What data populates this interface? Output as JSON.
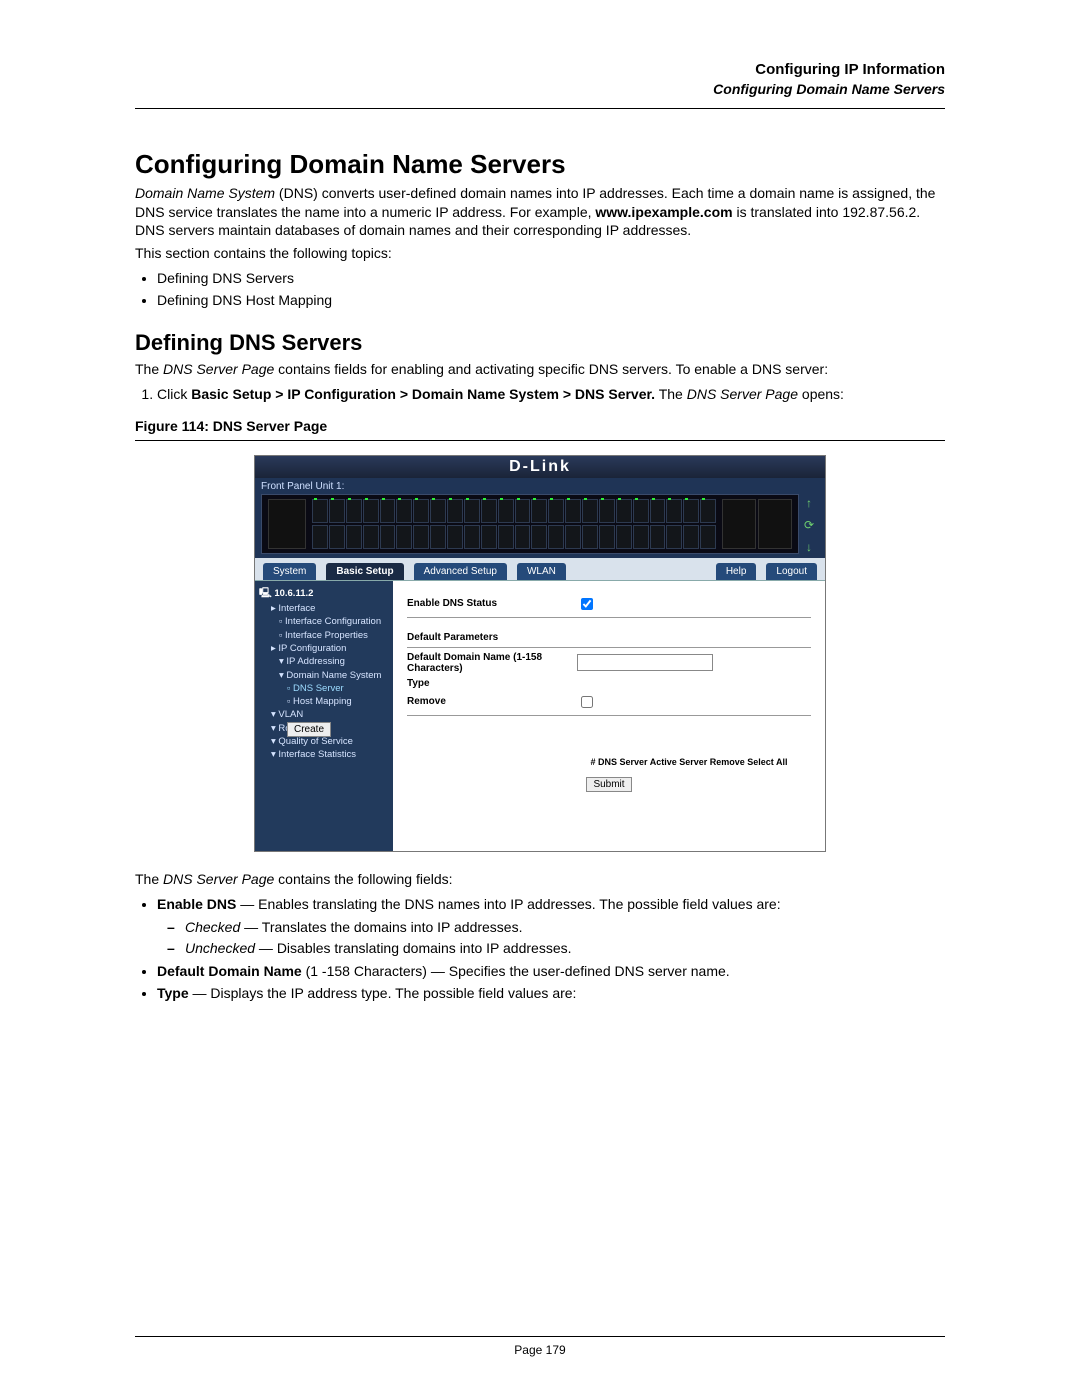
{
  "header": {
    "line1": "Configuring IP Information",
    "line2": "Configuring Domain Name Servers"
  },
  "h1": "Configuring Domain Name Servers",
  "intro_parts": {
    "a": "Domain Name System",
    "b": " (DNS) converts user-defined domain names into IP addresses. Each time a domain name is assigned, the DNS service translates the name into a numeric IP address. For example, ",
    "c": "www.ipexample.com",
    "d": " is translated into 192.87.56.2. DNS servers maintain databases of domain names and their corresponding IP addresses."
  },
  "section_contains": "This section contains the following topics:",
  "topics": [
    "Defining DNS Servers",
    "Defining DNS Host Mapping"
  ],
  "h2": "Defining DNS Servers",
  "dns_intro_parts": {
    "a": "The ",
    "b": "DNS Server Page",
    "c": " contains fields for enabling and activating specific DNS servers. To enable a DNS server:"
  },
  "step1_parts": {
    "a": "Click ",
    "b": "Basic Setup > IP Configuration > Domain Name System > DNS Server.",
    "c": " The ",
    "d": "DNS Server Page",
    "e": " opens:"
  },
  "figure_caption": "Figure 114: DNS Server Page",
  "screenshot": {
    "brand": "D-Link",
    "front_panel_label": "Front Panel Unit 1:",
    "tabs": {
      "system": "System",
      "basic": "Basic Setup",
      "advanced": "Advanced Setup",
      "wlan": "WLAN",
      "help": "Help",
      "logout": "Logout"
    },
    "sidebar": {
      "ip": "10.6.11.2",
      "items": {
        "interface": "Interface",
        "iconf": "Interface Configuration",
        "iprop": "Interface Properties",
        "ipconf": "IP Configuration",
        "ipaddr": "IP Addressing",
        "dns": "Domain Name System",
        "dnsserver": "DNS Server",
        "hostmap": "Host Mapping",
        "vlan": "VLAN",
        "routing": "Routing",
        "qos": "Quality of Service",
        "ifstats": "Interface Statistics"
      }
    },
    "form": {
      "enable_label": "Enable DNS Status",
      "default_params_hdr": "Default Parameters",
      "default_domain_label": "Default Domain Name (1-158 Characters)",
      "type_label": "Type",
      "remove_label": "Remove",
      "create_btn": "Create",
      "table_header": "# DNS Server Active Server Remove Select All",
      "submit_btn": "Submit"
    }
  },
  "fields_intro_parts": {
    "a": "The ",
    "b": "DNS Server Page",
    "c": " contains the following fields:"
  },
  "field_enable": {
    "name": "Enable DNS",
    "desc": " — Enables translating the DNS names into IP addresses. The possible field values are:"
  },
  "field_enable_checked": {
    "a": "Checked",
    "b": " — Translates the domains into IP addresses."
  },
  "field_enable_unchecked": {
    "a": "Unchecked",
    "b": " — Disables translating domains into IP addresses."
  },
  "field_default": {
    "name": "Default Domain Name",
    "desc": " (1 -158 Characters) — Specifies the user-defined DNS server name."
  },
  "field_type": {
    "name": "Type",
    "desc": " — Displays the IP address type. The possible field values are:"
  },
  "footer": {
    "page": "Page 179"
  }
}
